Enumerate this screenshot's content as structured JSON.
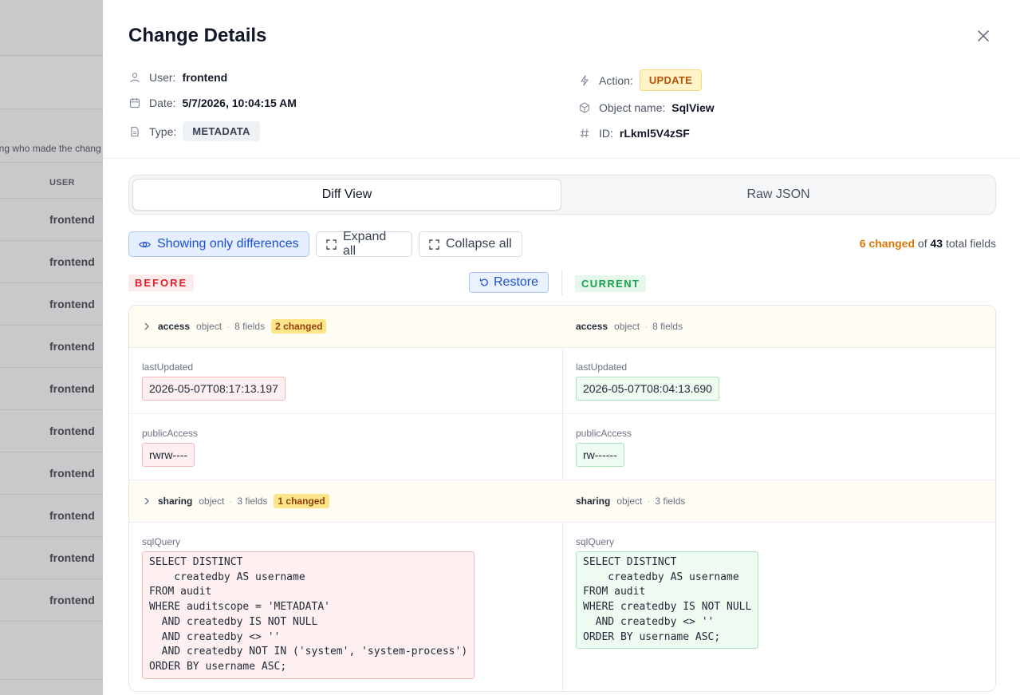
{
  "background": {
    "description_fragment": "ing who made the chang",
    "user_column_header": "USER",
    "rows": [
      "frontend",
      "frontend",
      "frontend",
      "frontend",
      "frontend",
      "frontend",
      "frontend",
      "frontend",
      "frontend",
      "frontend"
    ]
  },
  "drawer": {
    "title": "Change Details",
    "meta": {
      "user_label": "User:",
      "user_value": "frontend",
      "date_label": "Date:",
      "date_value": "5/7/2026, 10:04:15 AM",
      "type_label": "Type:",
      "type_value": "METADATA",
      "action_label": "Action:",
      "action_value": "UPDATE",
      "object_label": "Object name:",
      "object_value": "SqlView",
      "id_label": "ID:",
      "id_value": "rLkml5V4zSF"
    },
    "tabs": {
      "diff": "Diff View",
      "raw": "Raw JSON",
      "active": "diff"
    },
    "toolbar": {
      "showing_only": "Showing only differences",
      "expand_all": "Expand all",
      "collapse_all": "Collapse all",
      "changed_count": "6 changed",
      "of": "of",
      "total_count": "43",
      "total_suffix": "total fields"
    },
    "columns": {
      "before": "BEFORE",
      "current": "CURRENT",
      "restore": "Restore"
    },
    "diff": {
      "access": {
        "name": "access",
        "kind": "object",
        "fields": "8 fields",
        "changed": "2 changed"
      },
      "lastUpdated": {
        "label": "lastUpdated",
        "before": "2026-05-07T08:17:13.197",
        "current": "2026-05-07T08:04:13.690"
      },
      "publicAccess": {
        "label": "publicAccess",
        "before": "rwrw----",
        "current": "rw------"
      },
      "sharing": {
        "name": "sharing",
        "kind": "object",
        "fields": "3 fields",
        "changed": "1 changed"
      },
      "sqlQuery": {
        "label": "sqlQuery",
        "before": "SELECT DISTINCT\n    createdby AS username\nFROM audit\nWHERE auditscope = 'METADATA'\n  AND createdby IS NOT NULL\n  AND createdby <> ''\n  AND createdby NOT IN ('system', 'system-process')\nORDER BY username ASC;",
        "current": "SELECT DISTINCT\n    createdby AS username\nFROM audit\nWHERE createdby IS NOT NULL\n  AND createdby <> ''\nORDER BY username ASC;"
      }
    }
  },
  "colors": {
    "accent": "#1d4ed8",
    "before": "#e11d2b",
    "current": "#16a34a",
    "changed": "#d97706"
  }
}
